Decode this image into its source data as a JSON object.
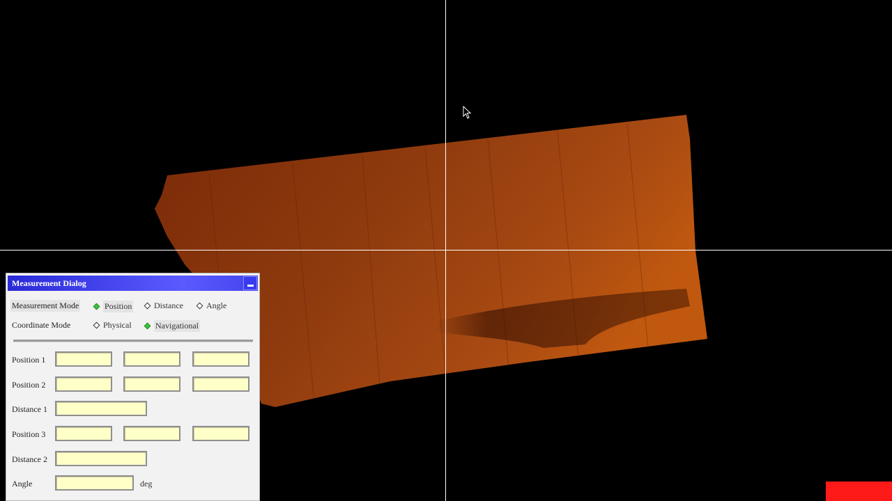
{
  "dialog": {
    "title": "Measurement Dialog",
    "measurement_mode": {
      "label": "Measurement Mode",
      "options": [
        "Position",
        "Distance",
        "Angle"
      ],
      "selected": "Position"
    },
    "coordinate_mode": {
      "label": "Coordinate Mode",
      "options": [
        "Physical",
        "Navigational"
      ],
      "selected": "Navigational"
    },
    "rows": {
      "position1": {
        "label": "Position 1",
        "values": [
          "",
          "",
          ""
        ]
      },
      "position2": {
        "label": "Position 2",
        "values": [
          "",
          "",
          ""
        ]
      },
      "distance1": {
        "label": "Distance 1",
        "value": ""
      },
      "position3": {
        "label": "Position 3",
        "values": [
          "",
          "",
          ""
        ]
      },
      "distance2": {
        "label": "Distance 2",
        "value": ""
      },
      "angle": {
        "label": "Angle",
        "value": "",
        "unit": "deg"
      }
    }
  },
  "colors": {
    "background": "#000000",
    "crosshair": "#ffffff",
    "surface": "#8a3a0c",
    "dialog_title": "#3030e0",
    "field_fill": "#ffffc8",
    "selected_radio": "#3bc43b",
    "indicator": "#ff1a1a"
  }
}
